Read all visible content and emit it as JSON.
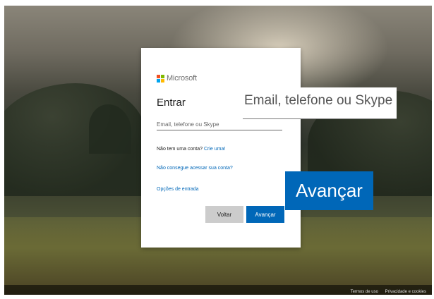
{
  "brand": {
    "name": "Microsoft",
    "logo_colors": [
      "#f25022",
      "#7fba00",
      "#00a4ef",
      "#ffb900"
    ]
  },
  "signin": {
    "title": "Entrar",
    "email_placeholder": "Email, telefone ou Skype",
    "no_account_text": "Não tem uma conta?",
    "create_link": "Crie uma!",
    "cant_access_link": "Não consegue acessar sua conta?",
    "signin_options_link": "Opções de entrada",
    "back_button": "Voltar",
    "next_button": "Avançar"
  },
  "callouts": {
    "email_field": "Email, telefone ou Skype",
    "next_button": "Avançar"
  },
  "footer": {
    "terms": "Termos de uso",
    "privacy": "Privacidade e cookies"
  },
  "colors": {
    "accent": "#0067b8",
    "back_button": "#cccccc"
  }
}
